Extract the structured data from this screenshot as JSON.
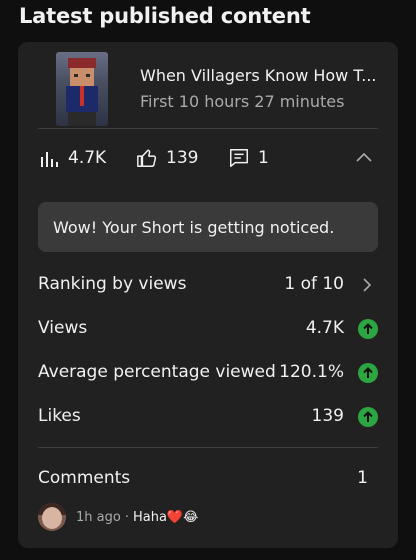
{
  "section": {
    "title": "Latest published content"
  },
  "video": {
    "title": "When Villagers Know How T...",
    "subtitle": "First 10 hours 27 minutes"
  },
  "stats": {
    "views": "4.7K",
    "likes": "139",
    "comments": "1"
  },
  "notice": {
    "text": "Wow! Your Short is getting noticed."
  },
  "metrics": [
    {
      "label": "Ranking by views",
      "value": "1 of 10",
      "indicator": "chevron-right"
    },
    {
      "label": "Views",
      "value": "4.7K",
      "indicator": "up-arrow"
    },
    {
      "label": "Average percentage viewed",
      "value": "120.1%",
      "indicator": "up-arrow"
    },
    {
      "label": "Likes",
      "value": "139",
      "indicator": "up-arrow"
    }
  ],
  "comments_section": {
    "label": "Comments",
    "count": "1"
  },
  "latest_comment": {
    "time": "1h ago",
    "separator": "·",
    "text": "Haha❤️😂"
  },
  "colors": {
    "background": "#0f0f0f",
    "card": "#212121",
    "notice_bg": "#3a3a3a",
    "up_green": "#2ba640",
    "secondary_text": "#aaaaaa"
  }
}
